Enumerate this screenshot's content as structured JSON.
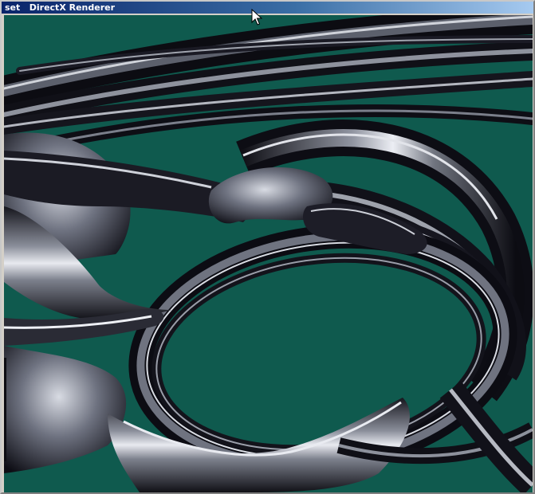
{
  "window": {
    "title": "set   DirectX Renderer",
    "colors": {
      "scene_background": "#0f5a4e",
      "titlebar_start": "#0a246a",
      "titlebar_end": "#a6caf0",
      "tube_dark": "#111118",
      "tube_mid": "#6b6f7c",
      "tube_highlight": "#e6e8ee"
    }
  },
  "viewport": {
    "description_icon": "render-viewport"
  },
  "cursor": {
    "icon": "arrow-cursor-icon"
  }
}
